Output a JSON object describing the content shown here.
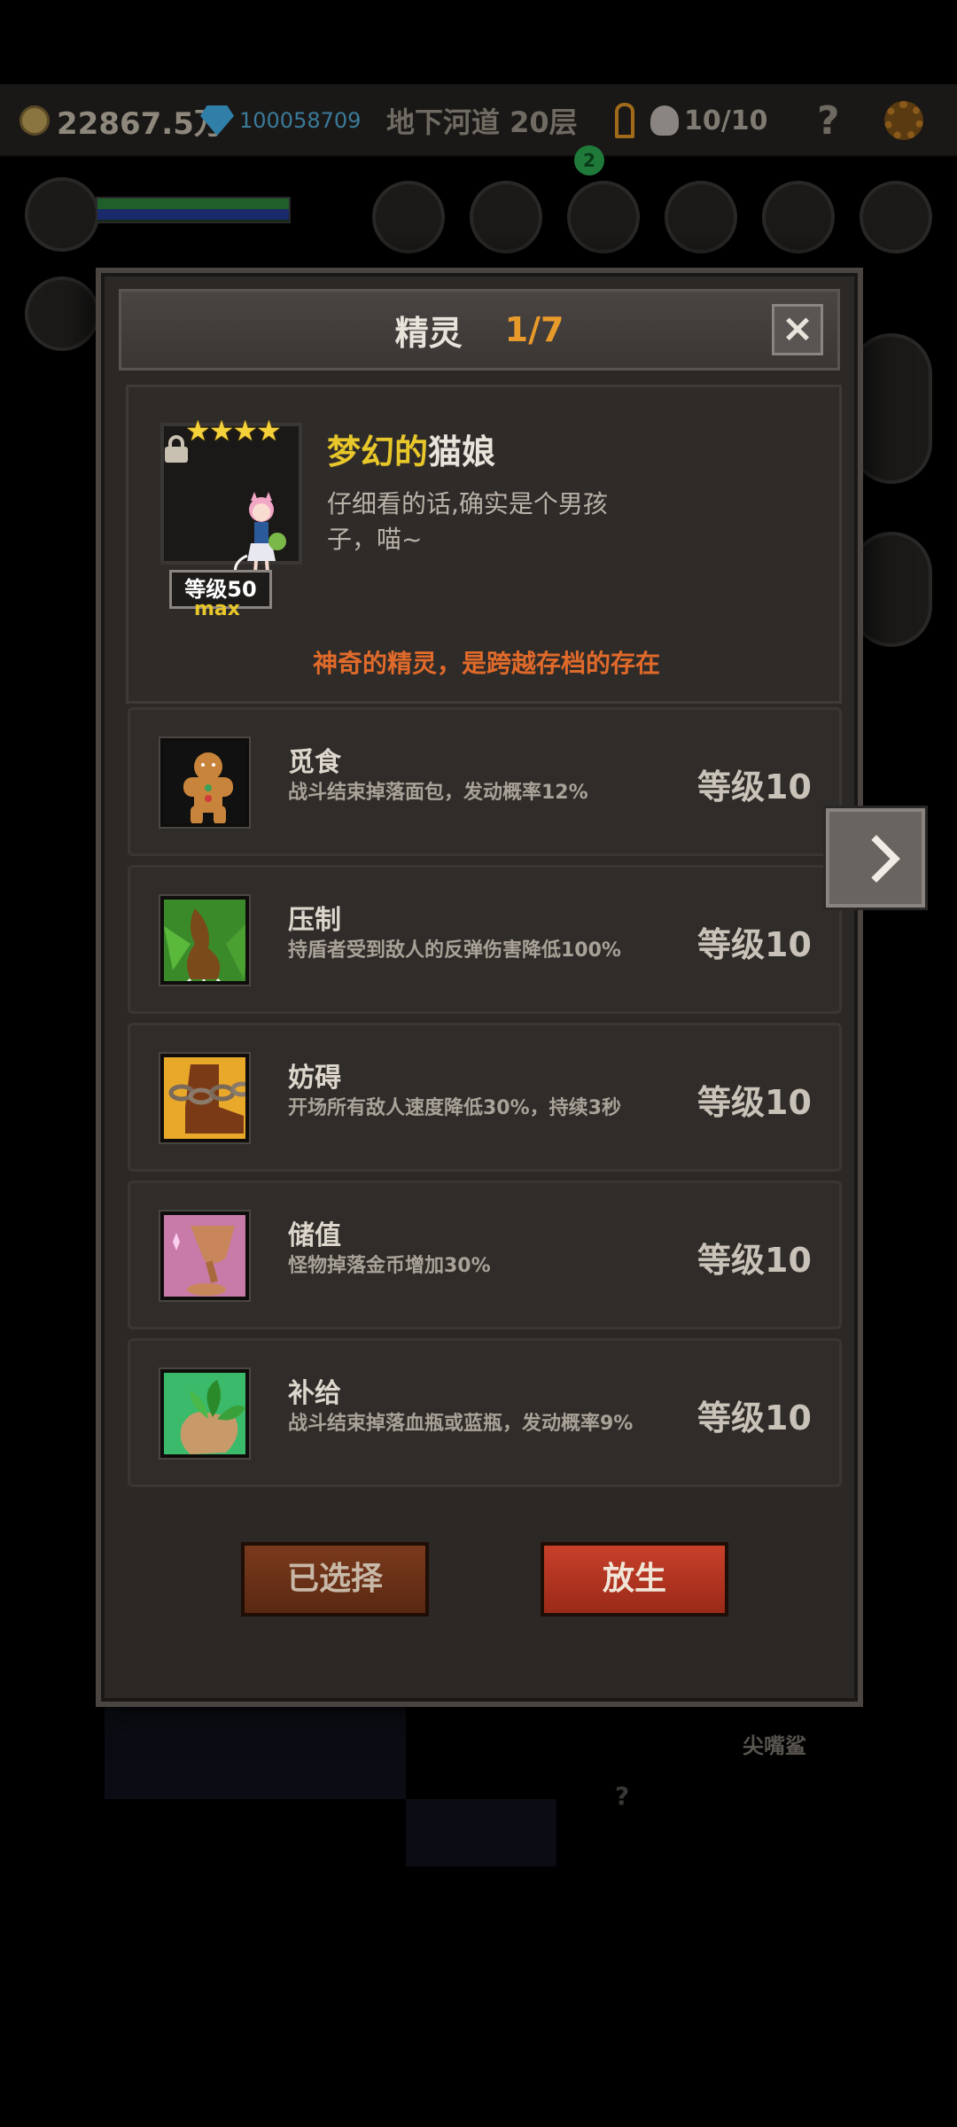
{
  "hud": {
    "gold": "22867.5万",
    "gems": "100058709",
    "floor": "地下河道 20层",
    "kills": "10/10",
    "help": "?",
    "badge": "2"
  },
  "background": {
    "enemy_label": "尖嘴鲨",
    "unknown": "?"
  },
  "dialog": {
    "title": "精灵",
    "count": "1/7",
    "close": "×",
    "spirit": {
      "stars": "★★★★",
      "level": "等级50",
      "max": "max",
      "name_prefix": "梦幻的",
      "name_suffix": "猫娘",
      "description": "仔细看的话,确实是个男孩子，喵~",
      "note": "神奇的精灵，是跨越存档的存在"
    },
    "skills": [
      {
        "name": "觅食",
        "desc": "战斗结束掉落面包，发动概率12%",
        "level": "等级10",
        "icon": "gingerbread-icon"
      },
      {
        "name": "压制",
        "desc": "持盾者受到敌人的反弹伤害降低100%",
        "level": "等级10",
        "icon": "claw-icon"
      },
      {
        "name": "妨碍",
        "desc": "开场所有敌人速度降低30%，持续3秒",
        "level": "等级10",
        "icon": "chained-boot-icon"
      },
      {
        "name": "储值",
        "desc": "怪物掉落金币增加30%",
        "level": "等级10",
        "icon": "goblet-icon"
      },
      {
        "name": "补给",
        "desc": "战斗结束掉落血瓶或蓝瓶，发动概率9%",
        "level": "等级10",
        "icon": "herb-hand-icon"
      }
    ],
    "buttons": {
      "selected": "已选择",
      "release": "放生"
    }
  }
}
